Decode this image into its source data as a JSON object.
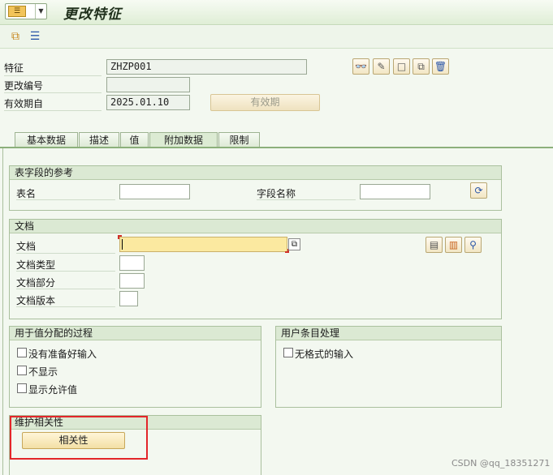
{
  "window": {
    "title": "更改特征"
  },
  "header": {
    "characteristic_label": "特征",
    "characteristic_value": "ZHZP001",
    "change_number_label": "更改编号",
    "change_number_value": "",
    "valid_from_label": "有效期自",
    "valid_from_value": "2025.01.10",
    "validity_button": "有效期"
  },
  "tabs": [
    {
      "label": "基本数据",
      "active": false
    },
    {
      "label": "描述",
      "active": false
    },
    {
      "label": "值",
      "active": false
    },
    {
      "label": "附加数据",
      "active": true
    },
    {
      "label": "限制",
      "active": false
    }
  ],
  "table_ref": {
    "title": "表字段的参考",
    "table_label": "表名",
    "table_value": "",
    "field_label": "字段名称",
    "field_value": ""
  },
  "document": {
    "title": "文档",
    "doc_label": "文档",
    "doc_value": "",
    "type_label": "文档类型",
    "type_value": "",
    "part_label": "文档部分",
    "part_value": "",
    "version_label": "文档版本",
    "version_value": ""
  },
  "value_proc": {
    "title": "用于值分配的过程",
    "opt1": "没有准备好输入",
    "opt2": "不显示",
    "opt3": "显示允许值"
  },
  "entry_proc": {
    "title": "用户条目处理",
    "opt1": "无格式的输入"
  },
  "dependency": {
    "title": "维护相关性",
    "button": "相关性"
  },
  "watermark": "CSDN @qq_18351271",
  "colors": {
    "accent": "#8cb07b",
    "highlight": "#e3262a",
    "button": "#f3dfa5"
  }
}
